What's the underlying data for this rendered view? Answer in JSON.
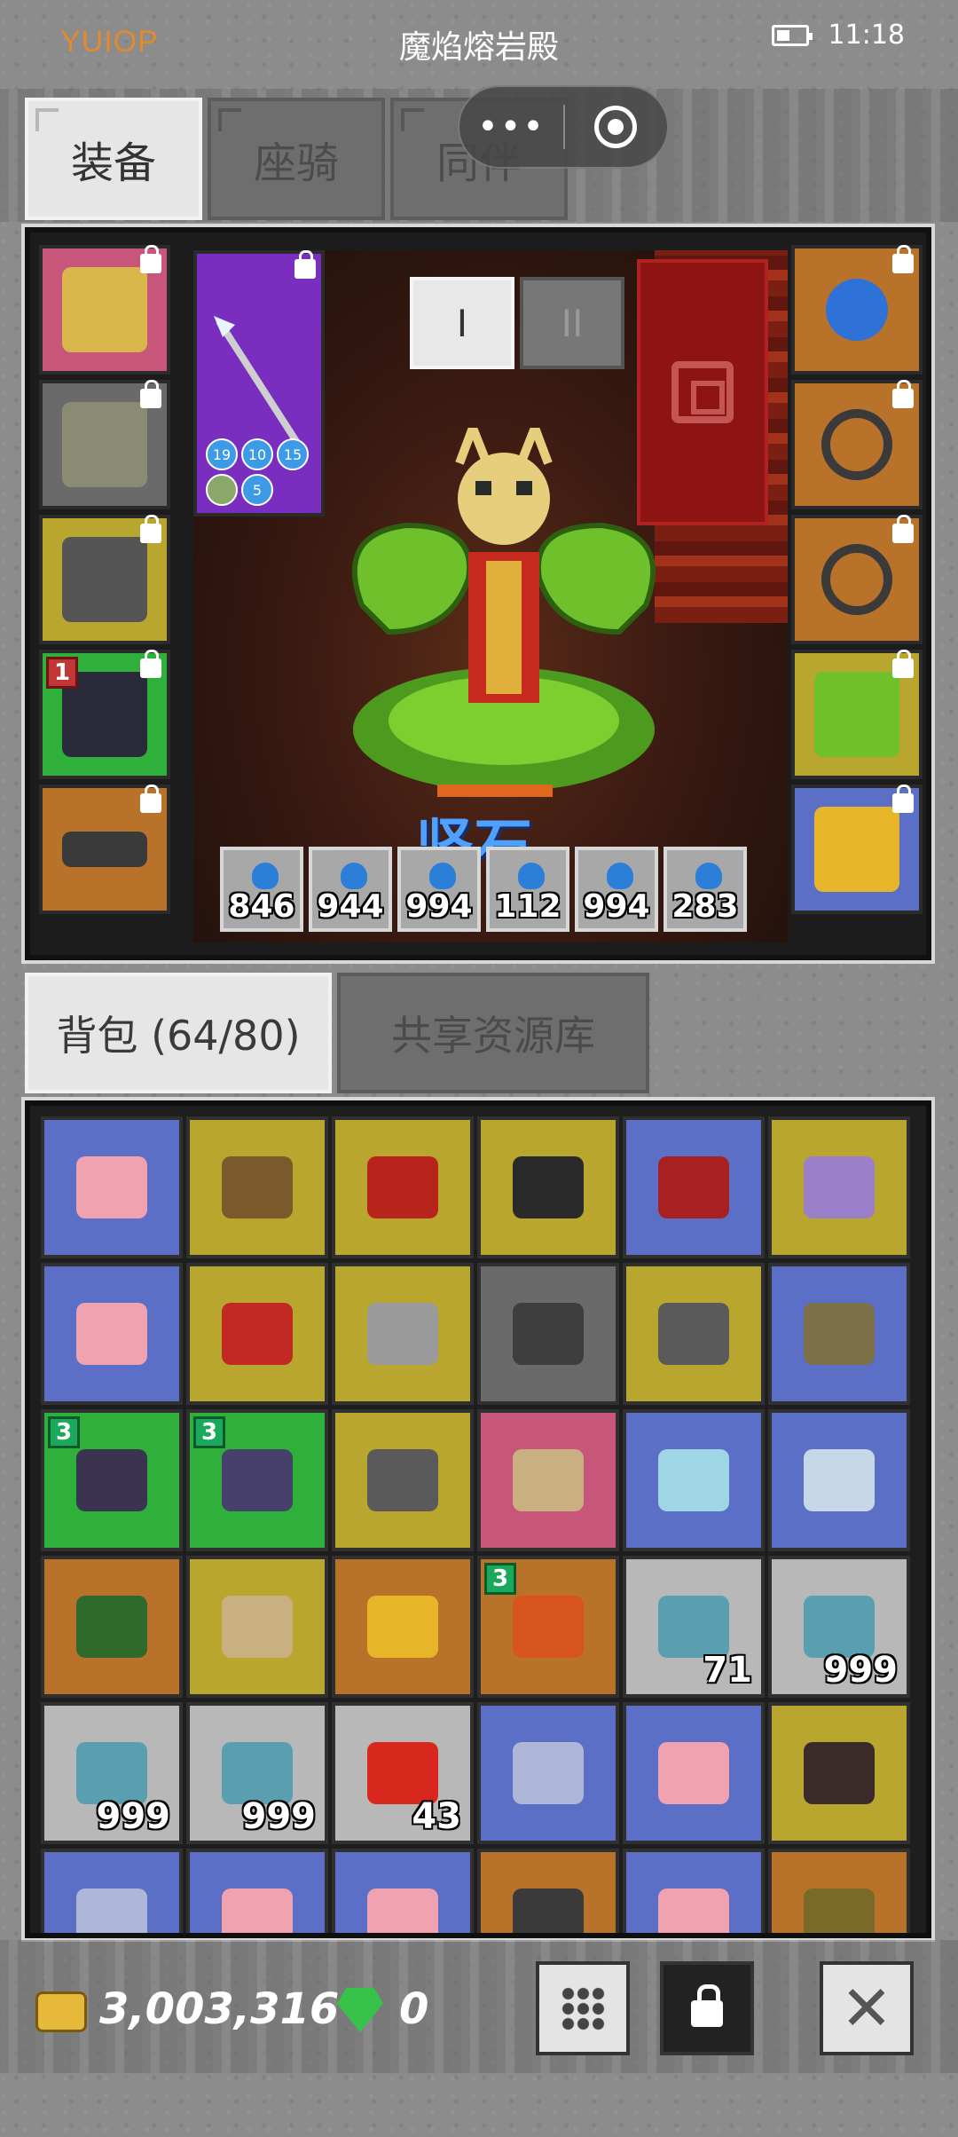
{
  "status_bar": {
    "left_text": "YUIOP",
    "title": "魔焰熔岩殿",
    "time": "11:18"
  },
  "top_tabs": [
    {
      "label": "装备",
      "active": true
    },
    {
      "label": "座骑",
      "active": false
    },
    {
      "label": "同伴",
      "active": false
    }
  ],
  "capsule": {
    "more_icon": "more-dots-icon",
    "close_icon": "target-circle-icon"
  },
  "equipment": {
    "page_tabs": [
      {
        "label": "I",
        "active": true
      },
      {
        "label": "II",
        "active": false
      }
    ],
    "hero_name": "坚石",
    "left_slots": [
      {
        "name": "helmet",
        "color": "#c8567a"
      },
      {
        "name": "armor",
        "color": "#6a6a6a"
      },
      {
        "name": "gauntlet",
        "color": "#b9a62e"
      },
      {
        "name": "boots",
        "color": "#2eb03a",
        "badge": "1"
      },
      {
        "name": "belt",
        "color": "#b9722a"
      }
    ],
    "weapon_slot": {
      "name": "spear",
      "color": "#7a2ec0",
      "stats": [
        "19",
        "10",
        "15",
        "",
        "5"
      ]
    },
    "right_slots": [
      {
        "name": "necklace",
        "color": "#b9722a"
      },
      {
        "name": "ring-1",
        "color": "#b9722a"
      },
      {
        "name": "ring-2",
        "color": "#b9722a"
      },
      {
        "name": "pet",
        "color": "#b9a62e"
      },
      {
        "name": "crown",
        "color": "#5b6fc6"
      }
    ],
    "potions": [
      "846",
      "944",
      "994",
      "112",
      "994",
      "283"
    ]
  },
  "bag_tabs": [
    {
      "label": "背包 (64/80)",
      "active": true
    },
    {
      "label": "共享资源库",
      "active": false
    }
  ],
  "bag_items": [
    {
      "name": "pink-crystal",
      "color": "#5b6fc6",
      "qty": ""
    },
    {
      "name": "hammer",
      "color": "#b9a62e",
      "qty": ""
    },
    {
      "name": "red-spear",
      "color": "#b9a62e",
      "qty": ""
    },
    {
      "name": "horned-helm",
      "color": "#b9a62e",
      "qty": ""
    },
    {
      "name": "red-bow",
      "color": "#5b6fc6",
      "qty": ""
    },
    {
      "name": "trident",
      "color": "#b9a62e",
      "qty": ""
    },
    {
      "name": "pink-crystal",
      "color": "#5b6fc6",
      "qty": ""
    },
    {
      "name": "red-sword",
      "color": "#b9a62e",
      "qty": ""
    },
    {
      "name": "chest-armor",
      "color": "#b9a62e",
      "qty": ""
    },
    {
      "name": "dark-armor",
      "color": "#6a6a6a",
      "qty": ""
    },
    {
      "name": "gauntlet",
      "color": "#b9a62e",
      "qty": ""
    },
    {
      "name": "orb-armor",
      "color": "#5b6fc6",
      "qty": ""
    },
    {
      "name": "boots",
      "color": "#2eb03a",
      "qty": "",
      "badge": "3"
    },
    {
      "name": "gloves",
      "color": "#2eb03a",
      "qty": "",
      "badge": "3"
    },
    {
      "name": "gauntlet",
      "color": "#b9a62e",
      "qty": ""
    },
    {
      "name": "crossbow",
      "color": "#c8567a",
      "qty": ""
    },
    {
      "name": "ring",
      "color": "#5b6fc6",
      "qty": ""
    },
    {
      "name": "scroll",
      "color": "#5b6fc6",
      "qty": ""
    },
    {
      "name": "green-glove",
      "color": "#b9722a",
      "qty": ""
    },
    {
      "name": "crossbow",
      "color": "#b9a62e",
      "qty": ""
    },
    {
      "name": "amulet",
      "color": "#b9722a",
      "qty": ""
    },
    {
      "name": "fire-boots",
      "color": "#b9722a",
      "qty": "",
      "badge": "3"
    },
    {
      "name": "fish",
      "color": "#b8b8b8",
      "qty": "71"
    },
    {
      "name": "fish",
      "color": "#b8b8b8",
      "qty": "999"
    },
    {
      "name": "fish",
      "color": "#b8b8b8",
      "qty": "999"
    },
    {
      "name": "fish",
      "color": "#b8b8b8",
      "qty": "999"
    },
    {
      "name": "red-leaf",
      "color": "#b8b8b8",
      "qty": "43"
    },
    {
      "name": "blue-gem",
      "color": "#5b6fc6",
      "qty": ""
    },
    {
      "name": "pink-scroll",
      "color": "#5b6fc6",
      "qty": ""
    },
    {
      "name": "monster-pet",
      "color": "#b9a62e",
      "qty": ""
    },
    {
      "name": "blue-gem",
      "color": "#5b6fc6",
      "qty": ""
    },
    {
      "name": "pink-crystal",
      "color": "#5b6fc6",
      "qty": ""
    },
    {
      "name": "pink-crystal",
      "color": "#5b6fc6",
      "qty": ""
    },
    {
      "name": "dark-item",
      "color": "#b9722a",
      "qty": ""
    },
    {
      "name": "pink-scroll",
      "color": "#5b6fc6",
      "qty": ""
    },
    {
      "name": "gold-armor",
      "color": "#b9722a",
      "qty": ""
    }
  ],
  "currency": {
    "gold": "3,003,316",
    "gems": "0"
  }
}
